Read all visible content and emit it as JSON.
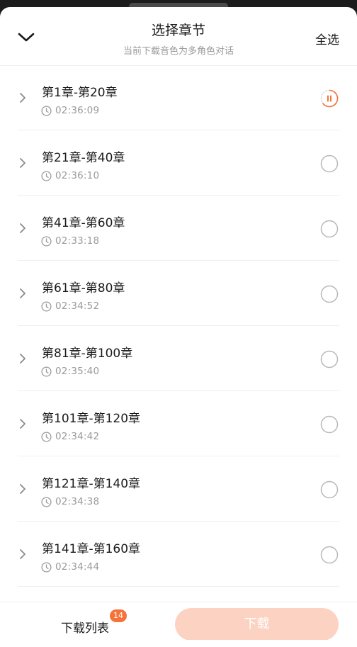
{
  "header": {
    "title": "选择章节",
    "subtitle": "当前下载音色为多角色对话",
    "select_all_label": "全选",
    "collapse_icon": "chevron-down-icon"
  },
  "chapters": [
    {
      "name": "第1章-第20章",
      "duration": "02:36:09",
      "status": "downloading-paused"
    },
    {
      "name": "第21章-第40章",
      "duration": "02:36:10",
      "status": "unselected"
    },
    {
      "name": "第41章-第60章",
      "duration": "02:33:18",
      "status": "unselected"
    },
    {
      "name": "第61章-第80章",
      "duration": "02:34:52",
      "status": "unselected"
    },
    {
      "name": "第81章-第100章",
      "duration": "02:35:40",
      "status": "unselected"
    },
    {
      "name": "第101章-第120章",
      "duration": "02:34:42",
      "status": "unselected"
    },
    {
      "name": "第121章-第140章",
      "duration": "02:34:38",
      "status": "unselected"
    },
    {
      "name": "第141章-第160章",
      "duration": "02:34:44",
      "status": "unselected"
    }
  ],
  "footer": {
    "download_list_label": "下载列表",
    "download_list_badge": "14",
    "download_button_label": "下载"
  },
  "colors": {
    "accent": "#f5733a",
    "download_button_disabled": "#fcd3c2",
    "secondary_text": "#9a9a9a",
    "icon_gray": "#8a8a8a"
  }
}
